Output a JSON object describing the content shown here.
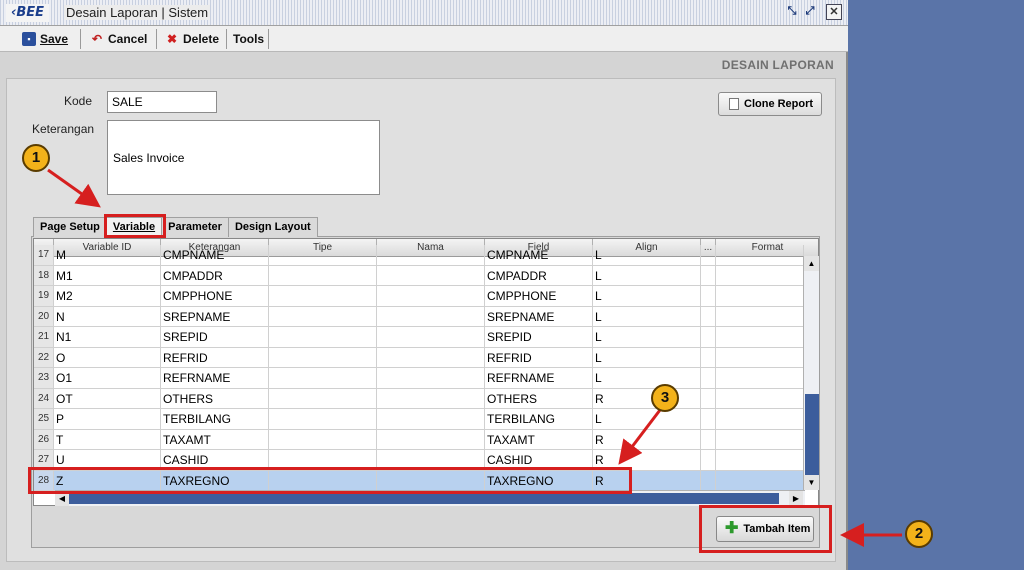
{
  "titlebar": {
    "brand": "BEE",
    "title": "Desain Laporan | Sistem",
    "controls": {
      "restore": "⤡",
      "maximize": "⤢",
      "close": "✕"
    }
  },
  "toolbar": {
    "save": {
      "label": "Save",
      "icon": "floppy-icon"
    },
    "cancel": {
      "label": "Cancel",
      "icon": "undo-icon"
    },
    "delete": {
      "label": "Delete",
      "icon": "x-icon"
    },
    "tools": {
      "label": "Tools"
    }
  },
  "header": {
    "title": "DESAIN LAPORAN"
  },
  "form": {
    "kode_label": "Kode",
    "kode_value": "SALE",
    "keterangan_label": "Keterangan",
    "keterangan_value": "Sales Invoice",
    "clone_button": "Clone Report"
  },
  "tabs": [
    {
      "label": "Page Setup"
    },
    {
      "label": "Variable",
      "active": true
    },
    {
      "label": "Parameter"
    },
    {
      "label": "Design Layout"
    }
  ],
  "grid": {
    "columns": [
      "",
      "Variable ID",
      "Keterangan",
      "Tipe",
      "Nama",
      "Field",
      "Align",
      "...",
      "Format"
    ],
    "rows": [
      {
        "no": "17",
        "id": "M",
        "ket": "CMPNAME",
        "field": "CMPNAME",
        "align": "L",
        "partial": true
      },
      {
        "no": "18",
        "id": "M1",
        "ket": "CMPADDR",
        "field": "CMPADDR",
        "align": "L"
      },
      {
        "no": "19",
        "id": "M2",
        "ket": "CMPPHONE",
        "field": "CMPPHONE",
        "align": "L"
      },
      {
        "no": "20",
        "id": "N",
        "ket": "SREPNAME",
        "field": "SREPNAME",
        "align": "L"
      },
      {
        "no": "21",
        "id": "N1",
        "ket": "SREPID",
        "field": "SREPID",
        "align": "L"
      },
      {
        "no": "22",
        "id": "O",
        "ket": "REFRID",
        "field": "REFRID",
        "align": "L"
      },
      {
        "no": "23",
        "id": "O1",
        "ket": "REFRNAME",
        "field": "REFRNAME",
        "align": "L"
      },
      {
        "no": "24",
        "id": "OT",
        "ket": "OTHERS",
        "field": "OTHERS",
        "align": "R"
      },
      {
        "no": "25",
        "id": "P",
        "ket": "TERBILANG",
        "field": "TERBILANG",
        "align": "L"
      },
      {
        "no": "26",
        "id": "T",
        "ket": "TAXAMT",
        "field": "TAXAMT",
        "align": "R"
      },
      {
        "no": "27",
        "id": "U",
        "ket": "CASHID",
        "field": "CASHID",
        "align": "R"
      },
      {
        "no": "28",
        "id": "Z",
        "ket": "TAXREGNO",
        "field": "TAXREGNO",
        "align": "R",
        "selected": true
      }
    ]
  },
  "tambah_button": "Tambah Item",
  "annotations": {
    "badge1": "1",
    "badge2": "2",
    "badge3": "3"
  },
  "colors": {
    "highlight": "#d61f1f",
    "badge": "#f3b21a",
    "selected_row": "#b8d1ef",
    "desktop": "#5a74a8"
  }
}
